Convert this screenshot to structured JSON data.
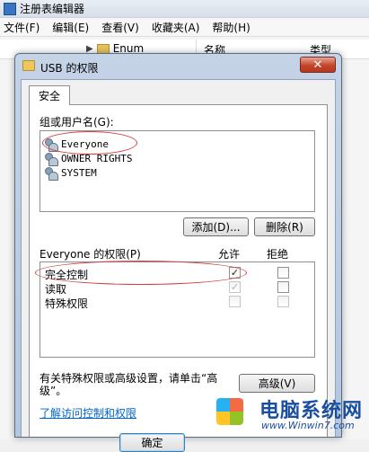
{
  "regedit": {
    "title": "注册表编辑器",
    "menu": [
      "文件(F)",
      "编辑(E)",
      "查看(V)",
      "收藏夹(A)",
      "帮助(H)"
    ],
    "tree_node": "Enum",
    "col_name": "名称",
    "col_type": "类型"
  },
  "dialog": {
    "title": "USB 的权限",
    "close_glyph": "✕",
    "tab": "安全",
    "group_label": "组或用户名(G):",
    "users": [
      "Everyone",
      "OWNER RIGHTS",
      "SYSTEM"
    ],
    "add_button": "添加(D)...",
    "remove_button": "删除(R)",
    "perm_label": "Everyone 的权限(P)",
    "allow_header": "允许",
    "deny_header": "拒绝",
    "permissions": [
      {
        "name": "完全控制",
        "allow": true,
        "allow_disabled": false,
        "deny": false,
        "deny_disabled": false
      },
      {
        "name": "读取",
        "allow": true,
        "allow_disabled": true,
        "deny": false,
        "deny_disabled": false
      },
      {
        "name": "特殊权限",
        "allow": false,
        "allow_disabled": true,
        "deny": false,
        "deny_disabled": true
      }
    ],
    "info_text": "有关特殊权限或高级设置，请单击“高级”。",
    "advanced_button": "高级(V)",
    "learn_link": "了解访问控制和权限",
    "ok_button": "确定"
  },
  "watermark": {
    "brand": "电脑系统网",
    "url": "www.Winwin7.com"
  },
  "colors": {
    "annotation": "#d04040",
    "link": "#0066cc"
  }
}
